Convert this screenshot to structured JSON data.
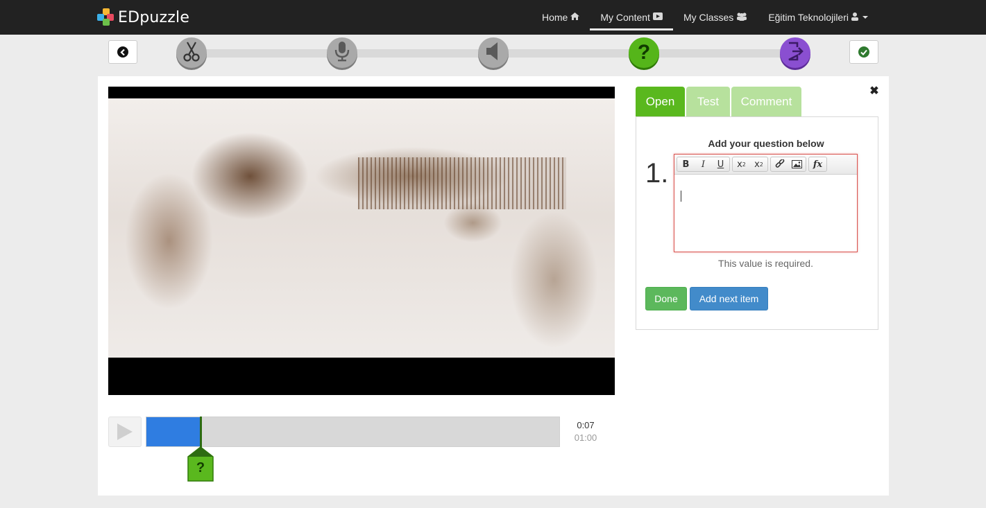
{
  "navbar": {
    "brand": "EDpuzzle",
    "links": [
      {
        "label": "Home",
        "icon": "home-icon"
      },
      {
        "label": "My Content",
        "icon": "video-icon",
        "active": true
      },
      {
        "label": "My Classes",
        "icon": "users-icon"
      },
      {
        "label": "Eğitim Teknolojileri",
        "icon": "user-icon"
      }
    ]
  },
  "steps": [
    {
      "name": "cut",
      "icon": "scissors-icon",
      "state": "inactive"
    },
    {
      "name": "voiceover",
      "icon": "microphone-icon",
      "state": "inactive"
    },
    {
      "name": "audio-notes",
      "icon": "speaker-icon",
      "state": "inactive"
    },
    {
      "name": "quiz",
      "icon": "question-icon",
      "state": "active"
    },
    {
      "name": "finish",
      "icon": "exit-icon",
      "state": "inactive"
    }
  ],
  "player": {
    "current_time": "0:07",
    "total_time": "01:00",
    "progress_fraction": 0.135,
    "question_marker_label": "?"
  },
  "editor": {
    "tabs": [
      {
        "label": "Open",
        "active": true
      },
      {
        "label": "Test",
        "active": false
      },
      {
        "label": "Comment",
        "active": false
      }
    ],
    "heading": "Add your question below",
    "question_number": "1.",
    "toolbar": [
      "bold-icon",
      "italic-icon",
      "underline-icon",
      "subscript-icon",
      "superscript-icon",
      "link-icon",
      "image-icon",
      "formula-icon"
    ],
    "validation_message": "This value is required.",
    "done_label": "Done",
    "add_next_label": "Add next item"
  },
  "colors": {
    "brand_green": "#5ab81e",
    "progress_blue": "#2f7de1",
    "purple": "#8a4fd1",
    "error_red": "#d9534f"
  }
}
